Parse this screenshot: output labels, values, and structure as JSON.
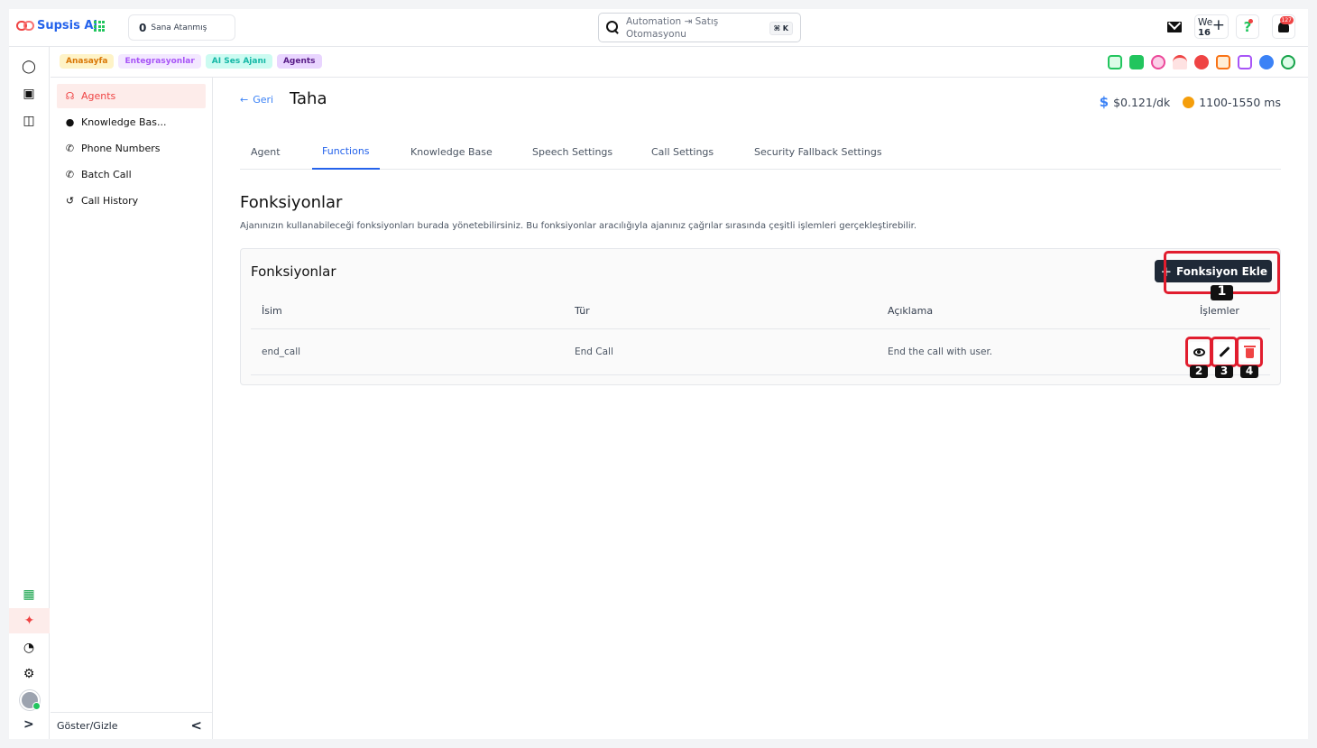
{
  "app": {
    "name": "Supsis Ai"
  },
  "topbar": {
    "assigned_count": "0",
    "assigned_label": "Sana Atanmış",
    "search_placeholder": "Automation ⇥ Satış Otomasyonu",
    "search_shortcut": "⌘ K",
    "we_label": "We",
    "we_number": "16",
    "help_glyph": "?",
    "notification_count": "127"
  },
  "breadcrumbs": [
    "Anasayfa",
    "Entegrasyonlar",
    "AI Ses Ajanı",
    "Agents"
  ],
  "channels": [
    {
      "icon": "bot-icon",
      "color": "#22c55e"
    },
    {
      "icon": "list-icon",
      "color": "#22c55e"
    },
    {
      "icon": "users-icon",
      "color": "#ec4899"
    },
    {
      "icon": "wifi-icon",
      "color": "#ef4444"
    },
    {
      "icon": "telegram-icon",
      "color": "#ef4444"
    },
    {
      "icon": "whatsapp-icon",
      "color": "#f97316"
    },
    {
      "icon": "instagram-icon",
      "color": "#a855f7"
    },
    {
      "icon": "messenger-icon",
      "color": "#3b82f6"
    },
    {
      "icon": "leaf-icon",
      "color": "#22c55e"
    }
  ],
  "sidebar": {
    "items": [
      {
        "label": "Agents",
        "icon": "headset-icon",
        "active": true
      },
      {
        "label": "Knowledge Bas...",
        "icon": "bulb-icon",
        "active": false
      },
      {
        "label": "Phone Numbers",
        "icon": "phone-icon",
        "active": false
      },
      {
        "label": "Batch Call",
        "icon": "phone-icon",
        "active": false
      },
      {
        "label": "Call History",
        "icon": "history-icon",
        "active": false
      }
    ],
    "toggle_label": "Göster/Gizle"
  },
  "header": {
    "back_label": "Geri",
    "agent_name": "Taha",
    "cost_label": "$0.121/dk",
    "latency_label": "1100-1550 ms"
  },
  "tabs": [
    "Agent",
    "Functions",
    "Knowledge Base",
    "Speech Settings",
    "Call Settings",
    "Security Fallback Settings"
  ],
  "active_tab": "Functions",
  "section": {
    "title": "Fonksiyonlar",
    "description": "Ajanınızın kullanabileceği fonksiyonları burada yönetebilirsiniz. Bu fonksiyonlar aracılığıyla ajanınız çağrılar sırasında çeşitli işlemleri gerçekleştirebilir."
  },
  "card": {
    "title": "Fonksiyonlar",
    "add_button": "Fonksiyon Ekle",
    "columns": [
      "İsim",
      "Tür",
      "Açıklama",
      "İşlemler"
    ],
    "rows": [
      {
        "name": "end_call",
        "type": "End Call",
        "description": "End the call with user."
      }
    ]
  },
  "annotations": [
    "1",
    "2",
    "3",
    "4"
  ],
  "colors": {
    "accent": "#2563eb",
    "brand": "#ef4444",
    "highlight": "#e11d2e"
  }
}
